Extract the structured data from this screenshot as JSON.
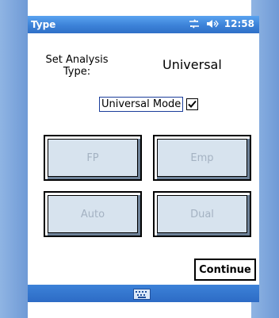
{
  "titlebar": {
    "title": "Type",
    "time": "12:58"
  },
  "form": {
    "label": "Set Analysis Type:",
    "value": "Universal",
    "mode_label": "Universal Mode",
    "mode_checked": true
  },
  "buttons": {
    "fp": "FP",
    "emp": "Emp",
    "auto": "Auto",
    "dual": "Dual",
    "continue": "Continue"
  },
  "icons": [
    "connectivity-icon",
    "volume-icon",
    "keyboard-icon",
    "checkmark-icon"
  ]
}
